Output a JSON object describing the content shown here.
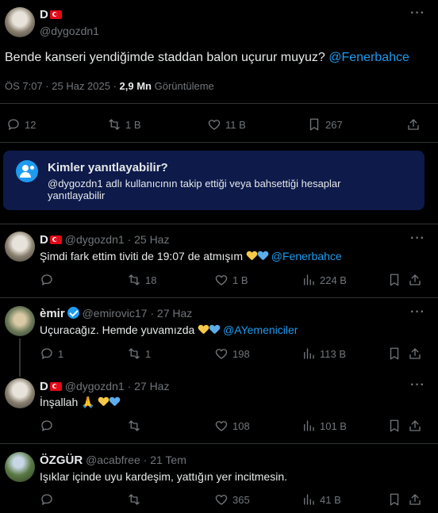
{
  "main_tweet": {
    "name": "D",
    "handle": "@dygozdn1",
    "text": "Bende kanseri yendiğimde staddan balon uçurur muyuz?",
    "mention": "@Fenerbahce",
    "time": "ÖS 7:07 · 25 Haz 2025 ·",
    "views_count": "2,9 Mn",
    "views_label": "Görüntüleme",
    "replies": "12",
    "retweets": "1 B",
    "likes": "11 B",
    "bookmarks": "267"
  },
  "reply_restriction": {
    "title": "Kimler yanıtlayabilir?",
    "body": "@dygozdn1 adlı kullanıcının takip ettiği veya bahsettiği hesaplar yanıtlayabilir"
  },
  "replies": [
    {
      "name": "D",
      "handle": "@dygozdn1",
      "date": "· 25 Haz",
      "text": "Şimdi fark ettim tiviti de 19:07 de atmışım",
      "mention": "@Fenerbahce",
      "replies": "",
      "retweets": "18",
      "likes": "1 B",
      "views": "224 B"
    },
    {
      "name": "èmir",
      "handle": "@emirovic17",
      "date": "· 27 Haz",
      "text": "Uçuracağız. Hemde yuvamızda",
      "mention": "@AYemeniciler",
      "replies": "1",
      "retweets": "1",
      "likes": "198",
      "views": "113 B"
    },
    {
      "name": "D",
      "handle": "@dygozdn1",
      "date": "· 27 Haz",
      "text": "İnşallah 🙏",
      "mention": "",
      "replies": "",
      "retweets": "",
      "likes": "108",
      "views": "101 B"
    },
    {
      "name": "ÖZGÜR",
      "handle": "@acabfree",
      "date": "· 21 Tem",
      "text": "Işıklar içinde uyu kardeşim, yattığın yer incitmesin.",
      "mention": "",
      "replies": "",
      "retweets": "",
      "likes": "365",
      "views": "41 B"
    }
  ],
  "colors": {
    "accent": "#1d9bf0",
    "background": "#000000",
    "muted": "#71767b",
    "card": "#0d1a4a"
  }
}
